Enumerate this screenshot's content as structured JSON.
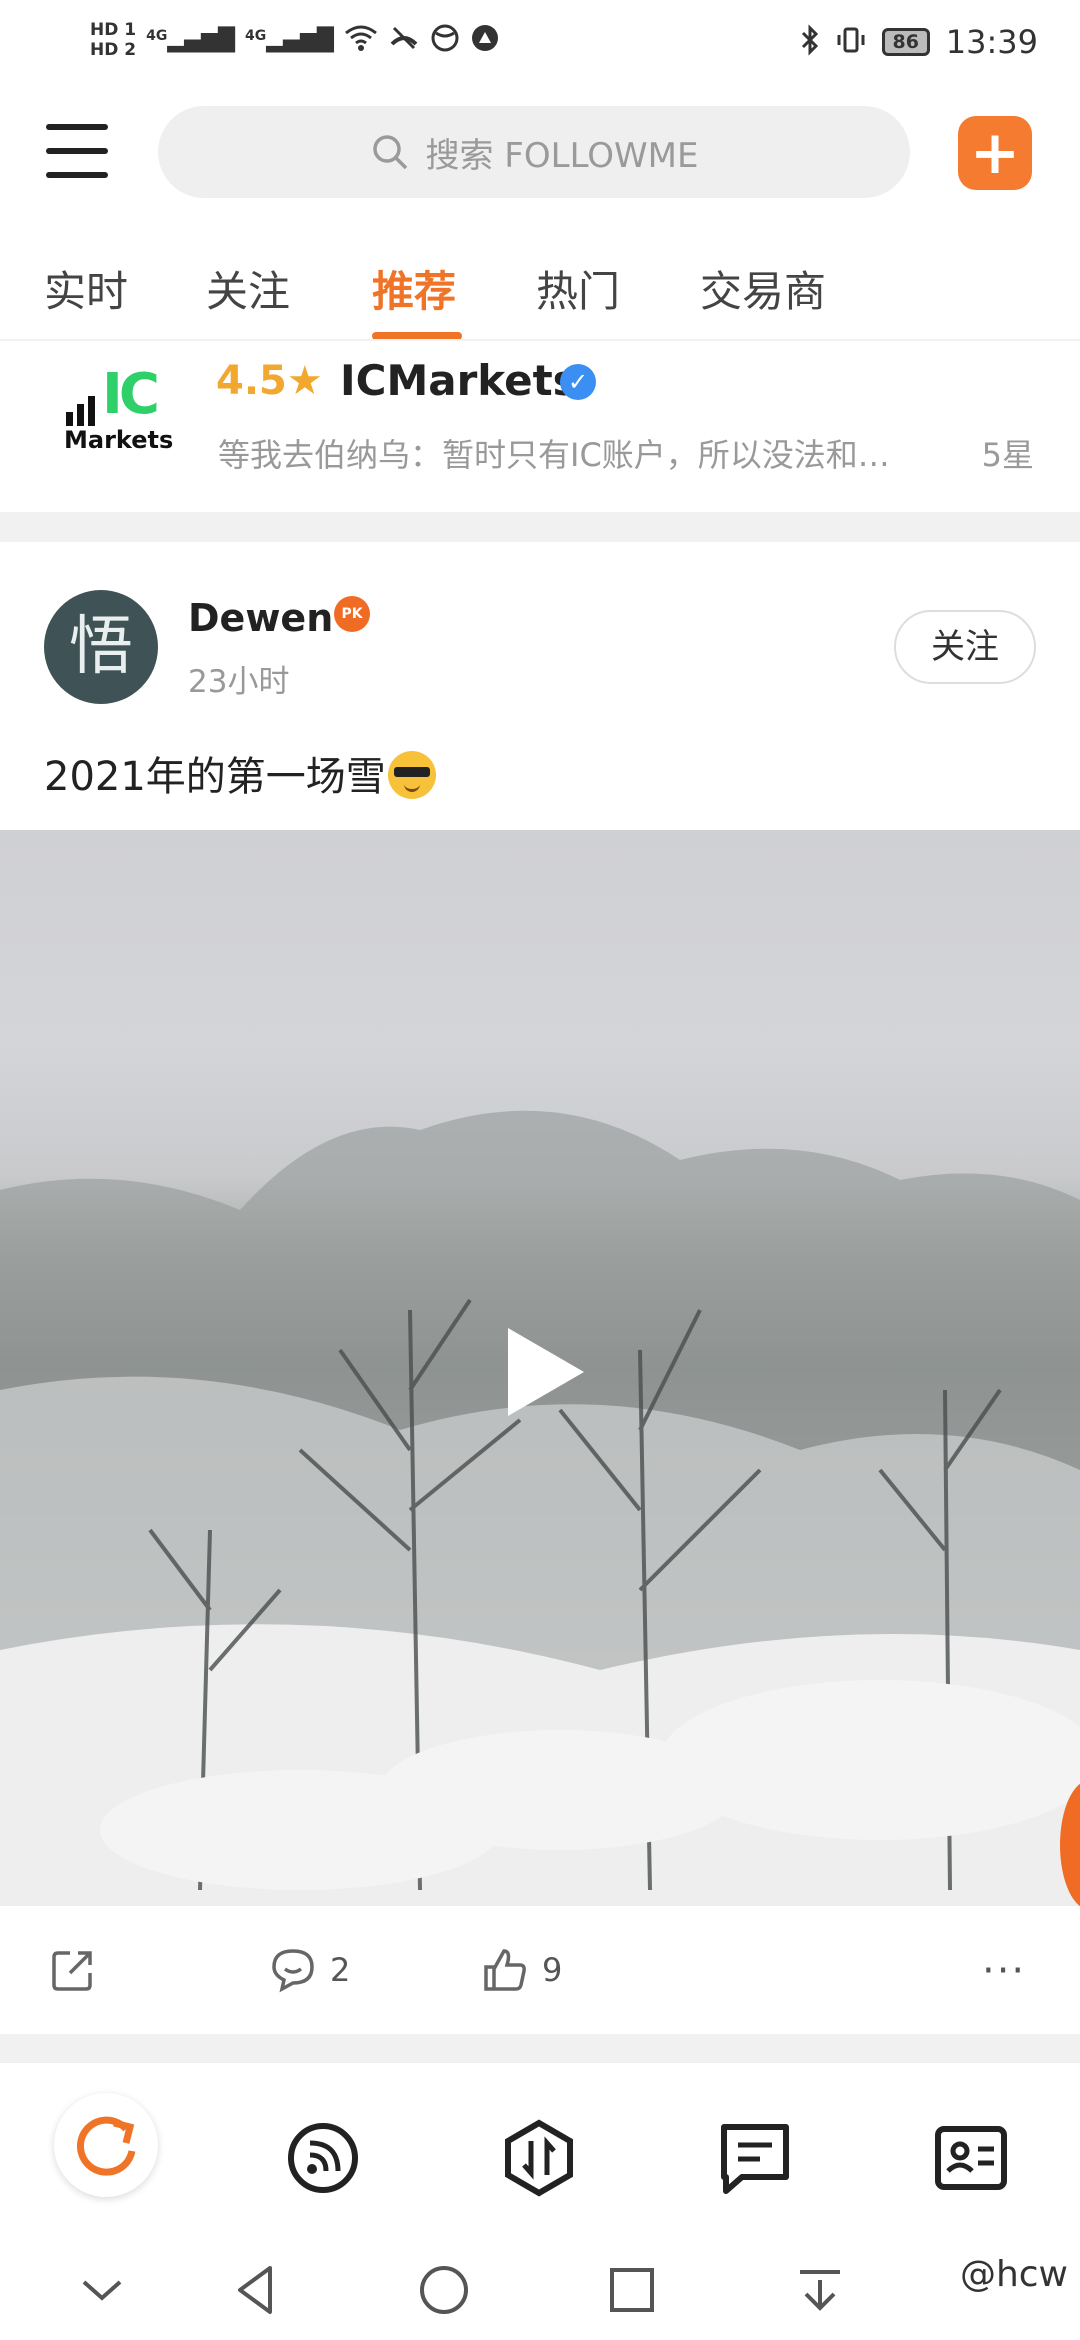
{
  "status_bar": {
    "hd1": "HD 1",
    "hd2": "HD 2",
    "net1": "4G",
    "net2": "4G",
    "battery": "86",
    "time": "13:39"
  },
  "header": {
    "search_placeholder": "搜索 FOLLOWME",
    "add_label": "+"
  },
  "tabs": [
    {
      "label": "实时"
    },
    {
      "label": "关注"
    },
    {
      "label": "推荐",
      "active": true
    },
    {
      "label": "热门"
    },
    {
      "label": "交易商"
    }
  ],
  "broker_card": {
    "logo_big": "IC",
    "logo_sub": "Markets",
    "rating": "4.5★",
    "name": "ICMarkets",
    "review": "等我去伯纳乌：暂时只有IC账户，所以没法和…",
    "review_stars": "5星"
  },
  "post": {
    "avatar_char": "悟",
    "author": "Dewen",
    "badge": "PK",
    "time": "23小时",
    "follow_label": "关注",
    "text": "2021年的第一场雪",
    "comments": "2",
    "likes": "9",
    "more": "···"
  },
  "watermark": "@hcw",
  "colors": {
    "accent": "#f07427",
    "rating": "#f2a72f",
    "verified": "#3b8ff3"
  }
}
